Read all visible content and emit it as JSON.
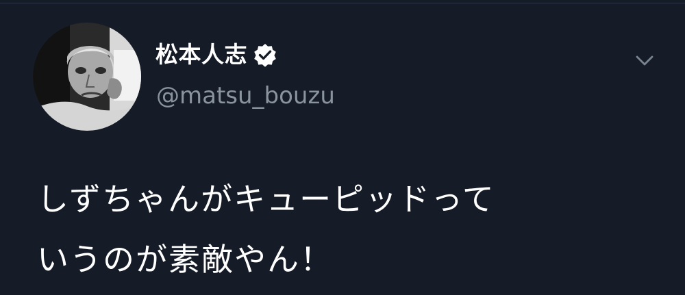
{
  "tweet": {
    "author": {
      "display_name": "松本人志",
      "handle": "@matsu_bouzu",
      "verified": true,
      "avatar_icon": "profile-photo"
    },
    "text_lines": [
      "しずちゃんがキューピッドって",
      "いうのが素敵やん！"
    ],
    "menu_icon": "chevron-down-icon"
  },
  "colors": {
    "background": "#151c28",
    "name": "#ffffff",
    "handle": "#8a949f",
    "text": "#ffffff",
    "chevron": "#7a8491"
  }
}
